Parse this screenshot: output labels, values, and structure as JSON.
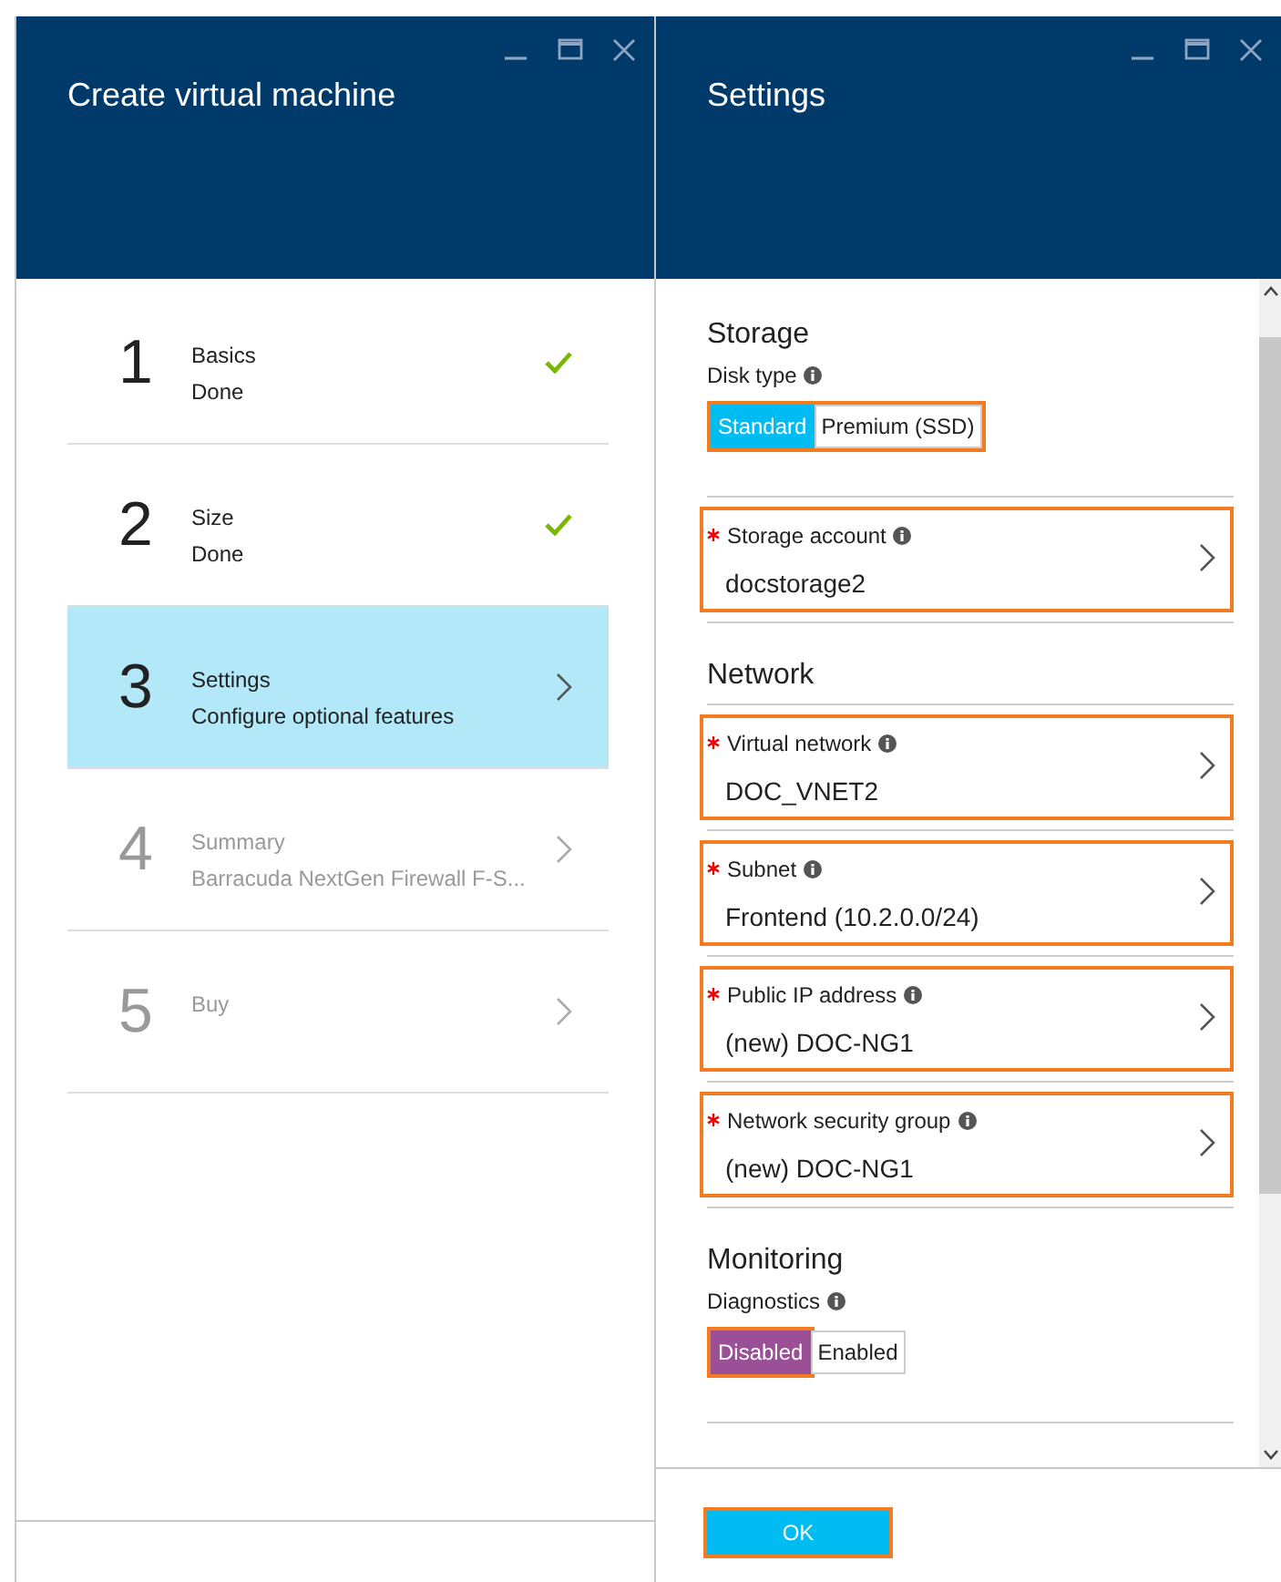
{
  "blades": [
    {
      "title": "Create virtual machine",
      "steps": [
        {
          "number": "1",
          "title": "Basics",
          "subtitle": "Done",
          "done": true,
          "disabled": false,
          "selected": false
        },
        {
          "number": "2",
          "title": "Size",
          "subtitle": "Done",
          "done": true,
          "disabled": false,
          "selected": false
        },
        {
          "number": "3",
          "title": "Settings",
          "subtitle": "Configure optional features",
          "done": false,
          "disabled": false,
          "selected": true
        },
        {
          "number": "4",
          "title": "Summary",
          "subtitle": "Barracuda NextGen Firewall F-S...",
          "done": false,
          "disabled": true,
          "selected": false
        },
        {
          "number": "5",
          "title": "Buy",
          "done": false,
          "disabled": true,
          "selected": false
        }
      ]
    },
    {
      "title": "Settings",
      "sections": [
        {
          "title": "Storage",
          "items": [
            {
              "kind": "toggle",
              "label": "Disk type",
              "highlighted": true,
              "color": "#00bcf2",
              "options": [
                {
                  "label": "Standard",
                  "selected": true,
                  "highlighted": false
                },
                {
                  "label": "Premium (SSD)",
                  "selected": false,
                  "highlighted": false
                }
              ]
            },
            {
              "kind": "field",
              "label": "Storage account",
              "required": true,
              "value": "docstorage2",
              "highlighted": true
            }
          ]
        },
        {
          "title": "Network",
          "items": [
            {
              "kind": "field",
              "label": "Virtual network",
              "required": true,
              "value": "DOC_VNET2",
              "highlighted": true
            },
            {
              "kind": "field",
              "label": "Subnet",
              "required": true,
              "value": "Frontend (10.2.0.0/24)",
              "highlighted": true
            },
            {
              "kind": "field",
              "label": "Public IP address",
              "required": true,
              "value": "(new) DOC-NG1",
              "highlighted": true
            },
            {
              "kind": "field",
              "label": "Network security group",
              "required": true,
              "value": "(new) DOC-NG1",
              "highlighted": true
            }
          ]
        },
        {
          "title": "Monitoring",
          "items": [
            {
              "kind": "toggle",
              "label": "Diagnostics",
              "color": "#9b4f96",
              "options": [
                {
                  "label": "Disabled",
                  "selected": true,
                  "highlighted": true
                },
                {
                  "label": "Enabled",
                  "selected": false,
                  "highlighted": false
                }
              ]
            }
          ]
        }
      ],
      "ok_button": {
        "label": "OK",
        "highlighted": true
      }
    }
  ]
}
